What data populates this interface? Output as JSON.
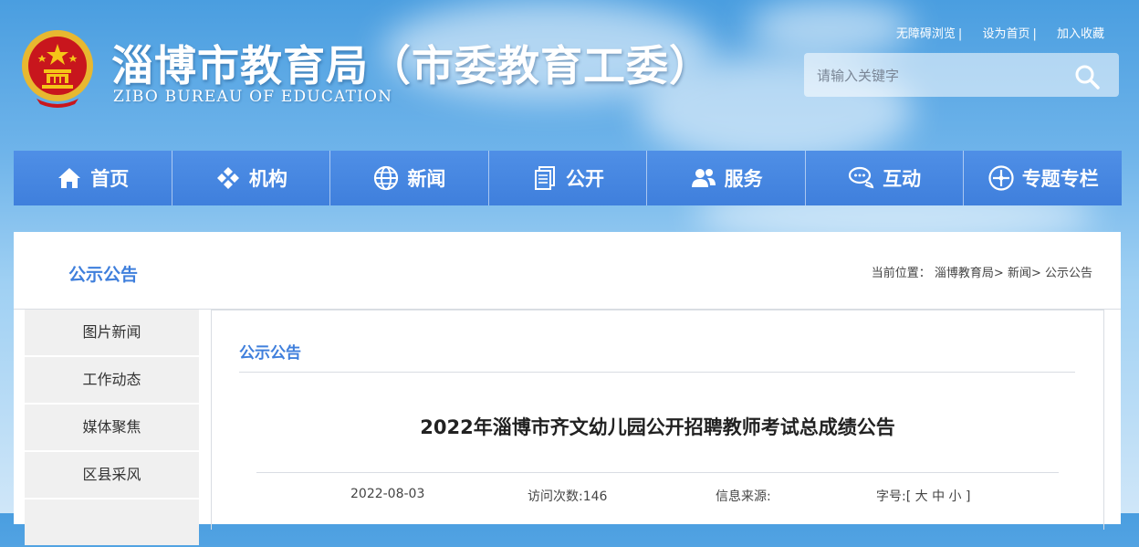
{
  "header": {
    "title_cn": "淄博市教育局（市委教育工委）",
    "title_en": "ZIBO BUREAU OF EDUCATION",
    "top_links": [
      "无障碍浏览",
      "设为首页",
      "加入收藏"
    ],
    "search_placeholder": "请输入关键字",
    "search_icon": "search-icon"
  },
  "nav": {
    "items": [
      {
        "label": "首页",
        "icon": "home-icon"
      },
      {
        "label": "机构",
        "icon": "org-icon"
      },
      {
        "label": "新闻",
        "icon": "globe-icon"
      },
      {
        "label": "公开",
        "icon": "document-icon"
      },
      {
        "label": "服务",
        "icon": "users-icon"
      },
      {
        "label": "互动",
        "icon": "chat-icon"
      },
      {
        "label": "专题专栏",
        "icon": "topics-icon"
      }
    ]
  },
  "section": {
    "title": "公示公告",
    "breadcrumb_prefix": "当前位置：",
    "breadcrumb": [
      "淄博教育局",
      "新闻",
      "公示公告"
    ]
  },
  "sidebar": {
    "items": [
      {
        "label": "图片新闻"
      },
      {
        "label": "工作动态"
      },
      {
        "label": "媒体聚焦"
      },
      {
        "label": "区县采风"
      }
    ]
  },
  "content": {
    "section_title": "公示公告",
    "article_title": "2022年淄博市齐文幼儿园公开招聘教师考试总成绩公告",
    "date": "2022-08-03",
    "visits_label": "访问次数:",
    "visits": "146",
    "source_label": "信息来源:",
    "source": "",
    "fontsize_label": "字号:",
    "fontsize_options": [
      "大",
      "中",
      "小"
    ]
  },
  "colors": {
    "accent": "#3f7fdc",
    "nav_bg": "#4f8fe6",
    "emblem_red": "#c8161d",
    "emblem_gold": "#f5c518"
  }
}
